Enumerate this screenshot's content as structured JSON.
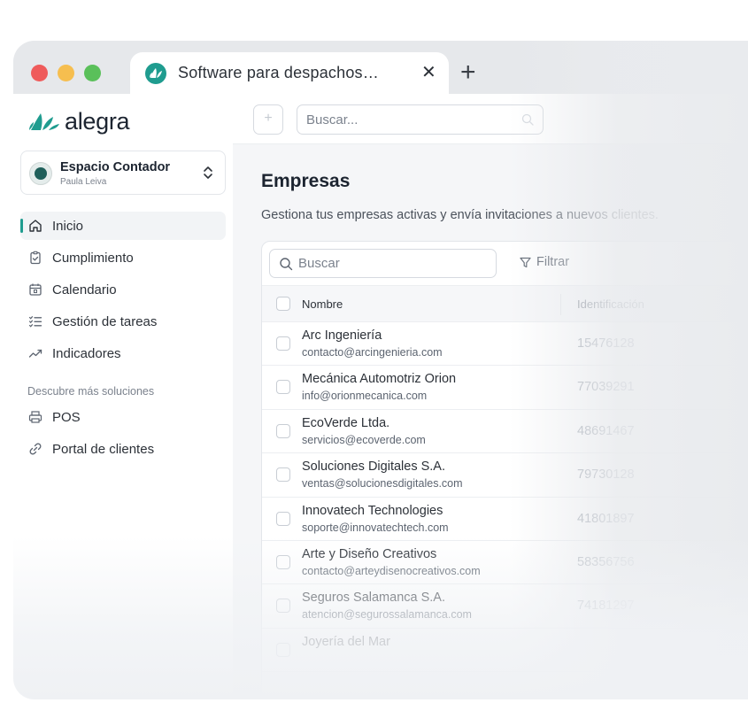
{
  "browser": {
    "tab_title": "Software para despachos…",
    "close_glyph": "✕",
    "new_tab_glyph": "+"
  },
  "brand": {
    "name": "alegra",
    "color": "#1f9c8f"
  },
  "topbar": {
    "add_glyph": "+",
    "search_placeholder": "Buscar..."
  },
  "workspace": {
    "name": "Espacio Contador",
    "user": "Paula Leiva"
  },
  "nav": {
    "items": [
      {
        "label": "Inicio",
        "icon": "home-icon"
      },
      {
        "label": "Cumplimiento",
        "icon": "clipboard-check-icon"
      },
      {
        "label": "Calendario",
        "icon": "calendar-icon"
      },
      {
        "label": "Gestión de tareas",
        "icon": "task-list-icon"
      },
      {
        "label": "Indicadores",
        "icon": "trend-icon"
      }
    ],
    "section_title": "Descubre más soluciones",
    "more": [
      {
        "label": "POS",
        "icon": "printer-icon"
      },
      {
        "label": "Portal de clientes",
        "icon": "link-icon"
      }
    ]
  },
  "main": {
    "title": "Empresas",
    "subtitle": "Gestiona tus empresas activas y envía invitaciones a nuevos clientes.",
    "search_placeholder": "Buscar",
    "filter_label": "Filtrar",
    "columns": {
      "name": "Nombre",
      "id": "Identificación"
    },
    "rows": [
      {
        "name": "Arc Ingeniería",
        "email": "contacto@arcingenieria.com",
        "id": "15476128"
      },
      {
        "name": "Mecánica Automotriz Orion",
        "email": "info@orionmecanica.com",
        "id": "77039291"
      },
      {
        "name": "EcoVerde Ltda.",
        "email": "servicios@ecoverde.com",
        "id": "48691467"
      },
      {
        "name": "Soluciones Digitales S.A.",
        "email": "ventas@solucionesdigitales.com",
        "id": "79730128"
      },
      {
        "name": "Innovatech Technologies",
        "email": "soporte@innovatechtech.com",
        "id": "41801897"
      },
      {
        "name": "Arte y Diseño Creativos",
        "email": "contacto@arteydisenocreativos.com",
        "id": "58356756"
      },
      {
        "name": "Seguros Salamanca S.A.",
        "email": "atencion@segurossalamanca.com",
        "id": "74181297"
      },
      {
        "name": "Joyería del Mar",
        "email": "",
        "id": ""
      }
    ]
  },
  "colors": {
    "accent": "#1f9c8f",
    "dot_red": "#ef5b5b",
    "dot_yellow": "#f6be4f",
    "dot_green": "#5ac05a"
  }
}
